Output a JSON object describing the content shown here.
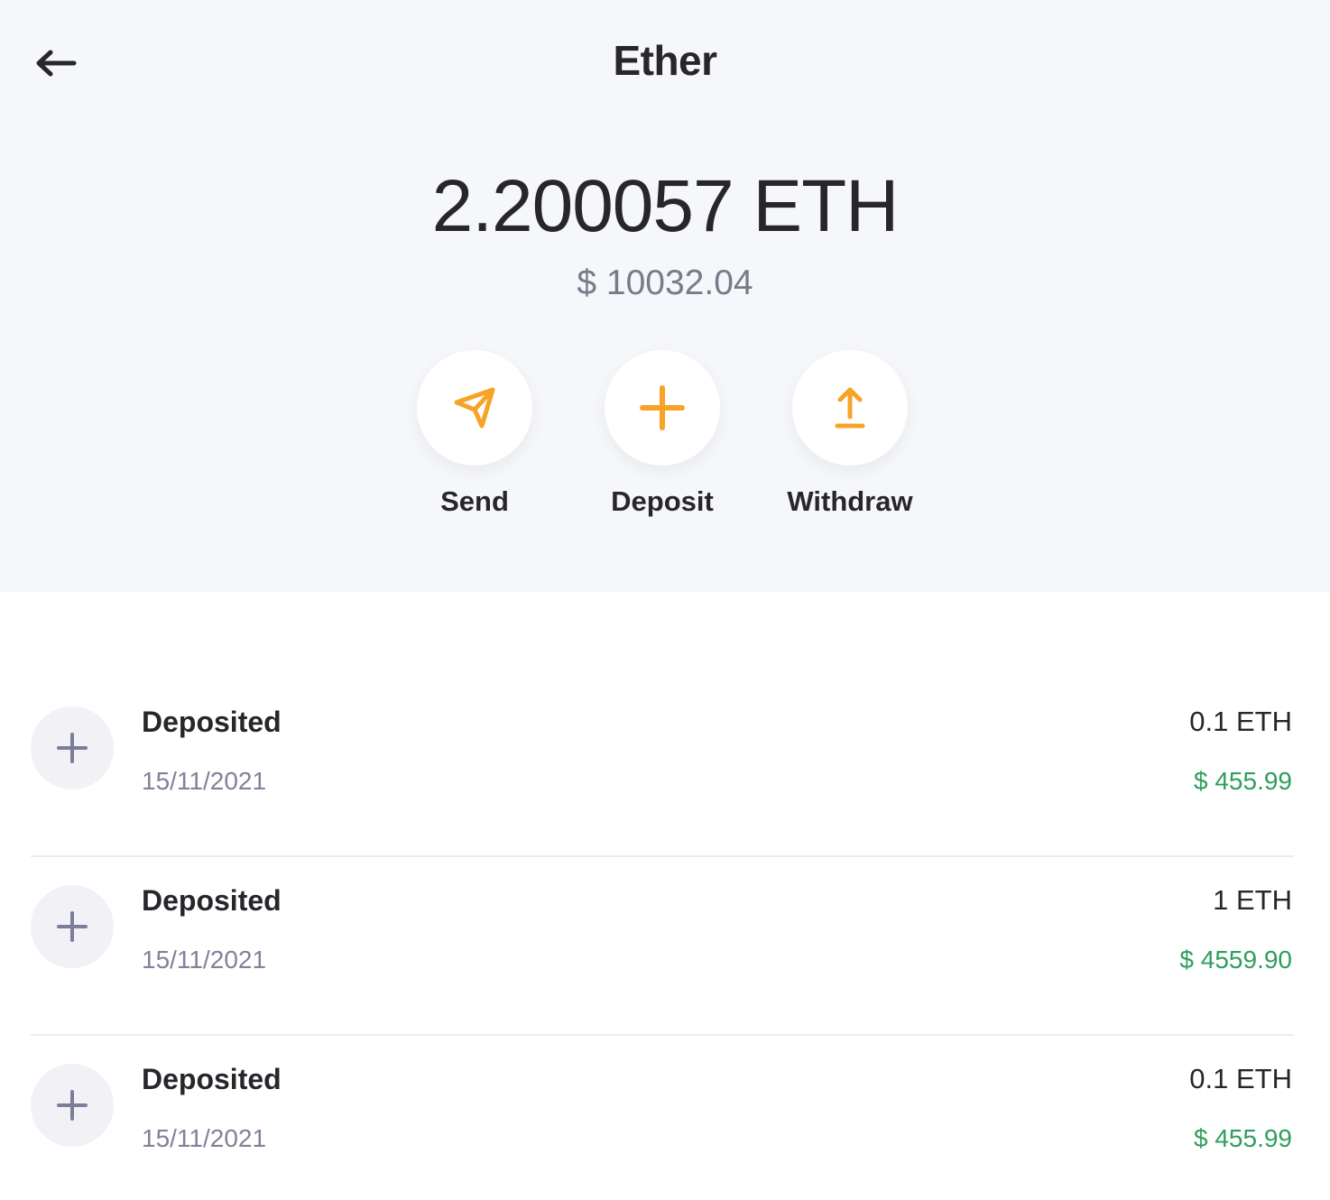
{
  "header": {
    "title": "Ether",
    "back_icon": "arrow-left-icon"
  },
  "balance": {
    "amount": "2.200057 ETH",
    "usd": "$ 10032.04"
  },
  "actions": [
    {
      "label": "Send",
      "icon": "send-icon"
    },
    {
      "label": "Deposit",
      "icon": "plus-icon"
    },
    {
      "label": "Withdraw",
      "icon": "upload-icon"
    }
  ],
  "transactions": [
    {
      "title": "Deposited",
      "date": "15/11/2021",
      "amount": "0.1 ETH",
      "usd": "$ 455.99",
      "icon": "plus-icon"
    },
    {
      "title": "Deposited",
      "date": "15/11/2021",
      "amount": "1 ETH",
      "usd": "$ 4559.90",
      "icon": "plus-icon"
    },
    {
      "title": "Deposited",
      "date": "15/11/2021",
      "amount": "0.1 ETH",
      "usd": "$ 455.99",
      "icon": "plus-icon"
    }
  ],
  "colors": {
    "accent": "#f7a325",
    "positive": "#2f9e5c",
    "muted": "#82819a"
  }
}
